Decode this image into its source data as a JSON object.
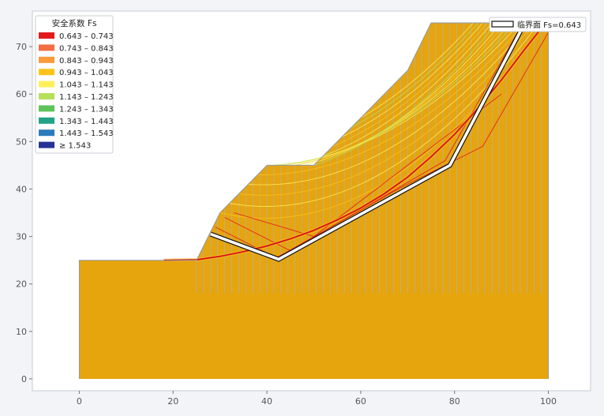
{
  "chart_data": {
    "type": "slope-stability",
    "xlim": [
      -10,
      109
    ],
    "ylim": [
      -2.5,
      77.5
    ],
    "x_ticks": [
      0,
      20,
      40,
      60,
      80,
      100
    ],
    "y_ticks": [
      0,
      10,
      20,
      30,
      40,
      50,
      60,
      70
    ],
    "grid": false,
    "slope_profile": [
      [
        0,
        0
      ],
      [
        0,
        25
      ],
      [
        25,
        25
      ],
      [
        30,
        35
      ],
      [
        40,
        45
      ],
      [
        50,
        45
      ],
      [
        55,
        50
      ],
      [
        60,
        55
      ],
      [
        65,
        60
      ],
      [
        70,
        65
      ],
      [
        75,
        75
      ],
      [
        100,
        75
      ],
      [
        100,
        0
      ]
    ],
    "slice_x_range": [
      25,
      100
    ],
    "slice_spacing": 1.5,
    "legend": {
      "title": "安全系数 Fs",
      "placement": "top-left",
      "items": [
        {
          "label": "0.643 – 0.743",
          "color": "#e31a1c"
        },
        {
          "label": "0.743 – 0.843",
          "color": "#f46d43"
        },
        {
          "label": "0.843 – 0.943",
          "color": "#fb9a3c"
        },
        {
          "label": "0.943 – 1.043",
          "color": "#fcc418"
        },
        {
          "label": "1.043 – 1.143",
          "color": "#ffef5a"
        },
        {
          "label": "1.143 – 1.243",
          "color": "#b5e05a"
        },
        {
          "label": "1.243 – 1.343",
          "color": "#5ec45a"
        },
        {
          "label": "1.343 – 1.443",
          "color": "#22a388"
        },
        {
          "label": "1.443 – 1.543",
          "color": "#2b7bba"
        },
        {
          "label": "≥ 1.543",
          "color": "#253494"
        }
      ]
    },
    "critical_surface": {
      "label": "临界面 Fs=0.643",
      "placement": "top-right",
      "points": [
        [
          28,
          30.5
        ],
        [
          42.5,
          25.2
        ],
        [
          79,
          45
        ],
        [
          95,
          75
        ]
      ]
    },
    "red_arc": {
      "points": [
        [
          18,
          25
        ],
        [
          25,
          25.1
        ],
        [
          30,
          25.8
        ],
        [
          35,
          26.8
        ],
        [
          40,
          28
        ],
        [
          45,
          29.5
        ],
        [
          50,
          31.3
        ],
        [
          55,
          33.5
        ],
        [
          60,
          36
        ],
        [
          65,
          39
        ],
        [
          70,
          42.5
        ],
        [
          75,
          46.8
        ],
        [
          80,
          51.5
        ],
        [
          85,
          57
        ],
        [
          90,
          63
        ],
        [
          95,
          69.5
        ],
        [
          99,
          74.5
        ]
      ]
    },
    "thin_red_lines": [
      [
        [
          29,
          32
        ],
        [
          42,
          25.5
        ],
        [
          68,
          40
        ],
        [
          86,
          49
        ],
        [
          100,
          73
        ]
      ],
      [
        [
          31,
          34
        ],
        [
          45,
          27
        ],
        [
          78,
          46
        ],
        [
          94,
          74
        ]
      ],
      [
        [
          33,
          35
        ],
        [
          50,
          30
        ],
        [
          90,
          60
        ]
      ]
    ],
    "fan_arcs": [
      {
        "x1": 30,
        "x2": 99,
        "sag": 1.0,
        "color": "#fcc418"
      },
      {
        "x1": 32,
        "x2": 98,
        "sag": 0.93,
        "color": "#ffef5a"
      },
      {
        "x1": 34,
        "x2": 97,
        "sag": 0.86,
        "color": "#fcc418"
      },
      {
        "x1": 36,
        "x2": 96,
        "sag": 0.8,
        "color": "#ffef5a"
      },
      {
        "x1": 38,
        "x2": 95,
        "sag": 0.74,
        "color": "#fcc418"
      },
      {
        "x1": 40,
        "x2": 94,
        "sag": 0.68,
        "color": "#ffef5a"
      },
      {
        "x1": 42,
        "x2": 93,
        "sag": 0.62,
        "color": "#b5e05a"
      },
      {
        "x1": 44,
        "x2": 92,
        "sag": 0.57,
        "color": "#ffef5a"
      },
      {
        "x1": 46,
        "x2": 91,
        "sag": 0.52,
        "color": "#fcc418"
      },
      {
        "x1": 48,
        "x2": 90,
        "sag": 0.47,
        "color": "#ffef5a"
      },
      {
        "x1": 50,
        "x2": 89,
        "sag": 0.42,
        "color": "#b5e05a"
      },
      {
        "x1": 52,
        "x2": 88,
        "sag": 0.38,
        "color": "#ffef5a"
      },
      {
        "x1": 54,
        "x2": 87,
        "sag": 0.34,
        "color": "#fcc418"
      },
      {
        "x1": 56,
        "x2": 86,
        "sag": 0.3,
        "color": "#ffef5a"
      },
      {
        "x1": 58,
        "x2": 85,
        "sag": 0.26,
        "color": "#b5e05a"
      },
      {
        "x1": 60,
        "x2": 84,
        "sag": 0.22,
        "color": "#ffef5a"
      }
    ],
    "colors": {
      "soil": "#e6a40d",
      "slice_line": "#a9b4c2",
      "outline": "#8f99a6",
      "axes_bg": "#ffffff",
      "critical_fill": "#ffffff",
      "critical_edge": "#111111"
    }
  }
}
